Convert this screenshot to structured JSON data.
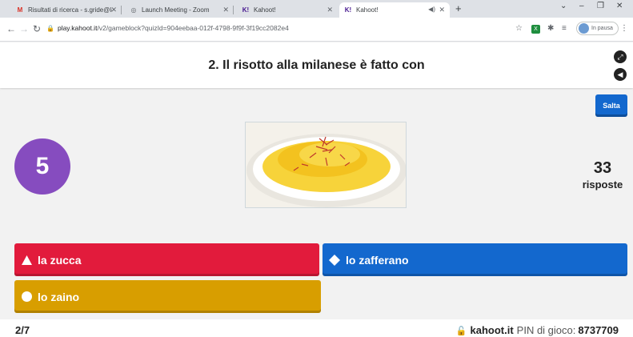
{
  "browser": {
    "tabs": [
      {
        "label": "Risultati di ricerca - s.gride@lade",
        "favicon": "M"
      },
      {
        "label": "Launch Meeting - Zoom",
        "favicon": "◎"
      },
      {
        "label": "Kahoot!",
        "favicon": "K!"
      },
      {
        "label": "Kahoot!",
        "favicon": "K!"
      }
    ],
    "new_tab": "+",
    "url_host": "play.kahoot.it",
    "url_path": "/v2/gameblock?quizId=904eebaa-012f-4798-9f9f-3f19cc2082e4",
    "profile_label": "In pausa",
    "window_controls": [
      "⌄",
      "–",
      "❐",
      "✕"
    ]
  },
  "quiz": {
    "question": "2. Il risotto alla milanese è fatto con",
    "skip_label": "Salta",
    "timer": "5",
    "answers_count": "33",
    "answers_label": "risposte",
    "answers": [
      {
        "label": "la zucca",
        "shape": "triangle",
        "color": "#e21b3c"
      },
      {
        "label": "lo zafferano",
        "shape": "diamond",
        "color": "#1368ce"
      },
      {
        "label": "lo zaino",
        "shape": "circle",
        "color": "#d89e00"
      }
    ]
  },
  "footer": {
    "progress": "2/7",
    "site": "kahoot.it",
    "pin_label": "PIN di gioco:",
    "pin_value": "8737709"
  },
  "colors": {
    "timer": "#864cbf",
    "skip": "#1368ce"
  }
}
